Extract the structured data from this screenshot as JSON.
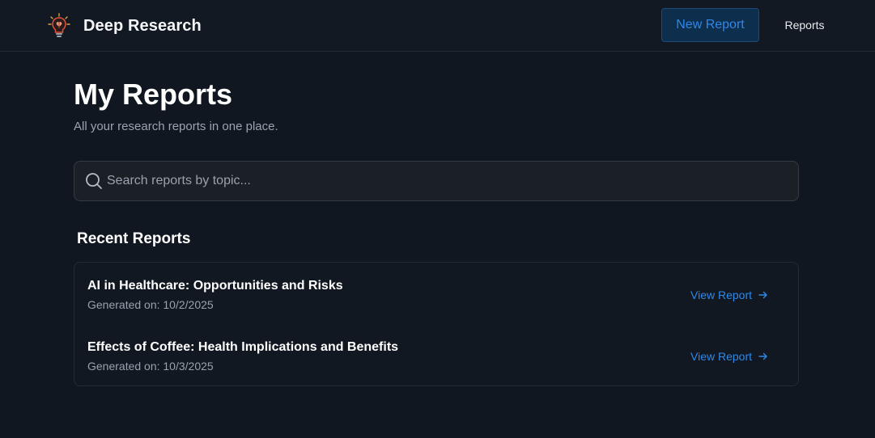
{
  "app": {
    "name": "Deep Research",
    "logo_icon": "lightbulb-brain-icon"
  },
  "nav": {
    "new_report_label": "New Report",
    "reports_label": "Reports"
  },
  "page": {
    "title": "My Reports",
    "subtitle": "All your research reports in one place."
  },
  "search": {
    "placeholder": "Search reports by topic...",
    "value": "",
    "icon": "search-icon"
  },
  "recent": {
    "heading": "Recent Reports",
    "reports": [
      {
        "title": "AI in Healthcare: Opportunities and Risks",
        "date": "Generated on: 10/2/2025",
        "link_label": "View Report"
      },
      {
        "title": "Effects of Coffee: Health Implications and Benefits",
        "date": "Generated on: 10/3/2025",
        "link_label": "View Report"
      }
    ]
  },
  "colors": {
    "background": "#111720",
    "accent": "#2f88e8",
    "button_bg": "#0e2e4e",
    "muted_text": "#9aa2ad"
  }
}
